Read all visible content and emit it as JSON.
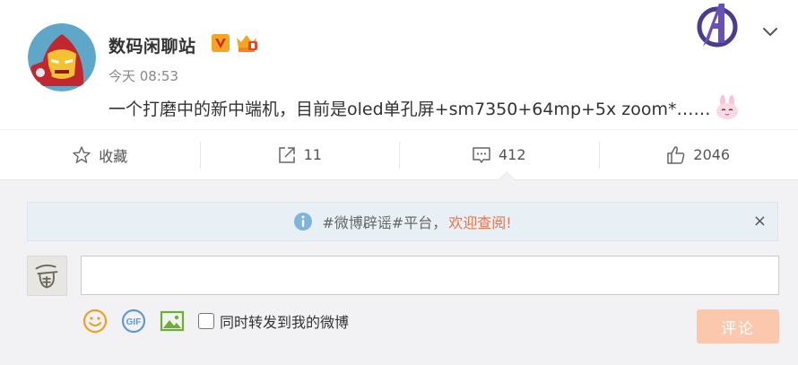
{
  "post": {
    "author": "数码闲聊站",
    "time": "今天 08:53",
    "text": "一个打磨中的新中端机，目前是oled单孔屏+sm7350+64mp+5x zoom*……",
    "badges": [
      "verified-v-badge",
      "vip-crown-badge"
    ],
    "avatar_icon": "iron-man-avatar",
    "emoji_icon": "bunny-emoji"
  },
  "actions": [
    {
      "label": "收藏",
      "icon": "star-icon"
    },
    {
      "label": "11",
      "icon": "share-icon"
    },
    {
      "label": "412",
      "icon": "comment-icon"
    },
    {
      "label": "2046",
      "icon": "thumbs-up-icon"
    }
  ],
  "notice": {
    "tag": "#微博辟谣#平台，",
    "link": "欢迎查阅!",
    "close": "×"
  },
  "composer": {
    "input_value": "",
    "repost_label": "同时转发到我的微博",
    "submit_label": "评论",
    "tools": [
      "emoji-icon",
      "gif-icon",
      "image-icon"
    ]
  },
  "colors": {
    "accent": "#eb7350",
    "submit_bg": "#fcc8ad",
    "notice_bg": "#e9f0f5",
    "panel_bg": "#f2f2f5"
  }
}
